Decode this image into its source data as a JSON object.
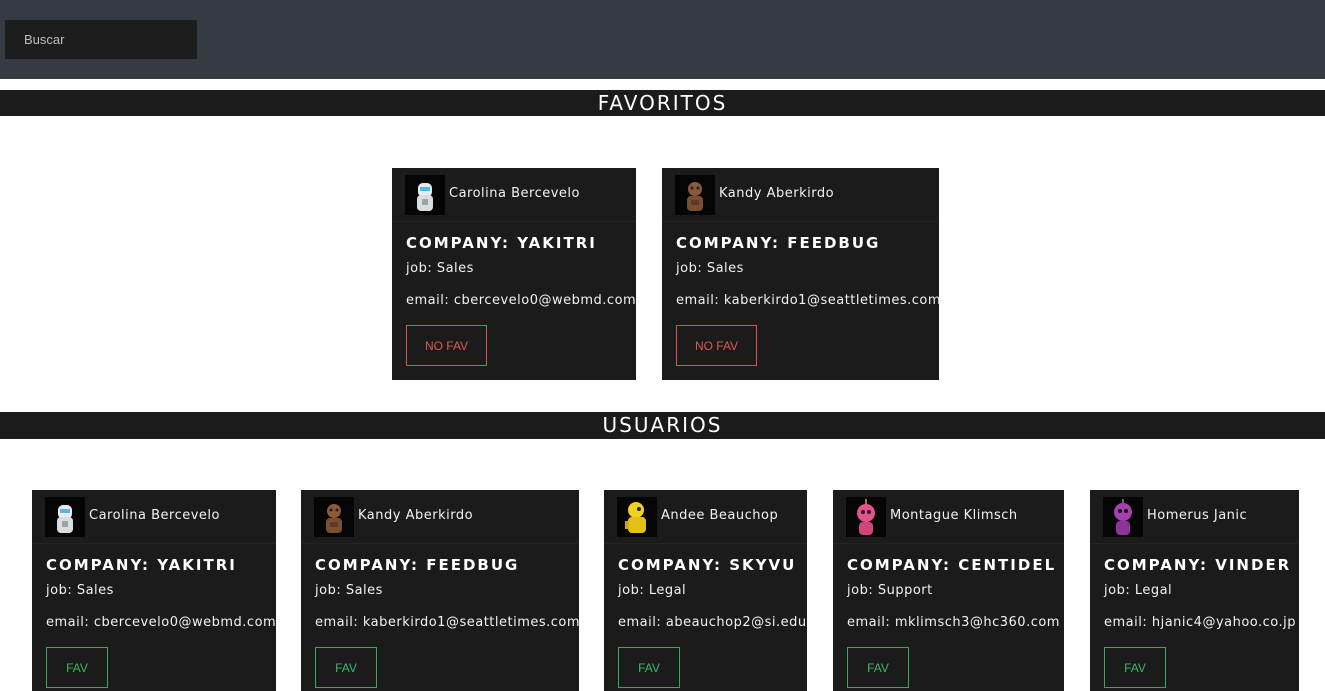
{
  "search": {
    "placeholder": "Buscar"
  },
  "sections": {
    "favorites_title": "FAVORITOS",
    "users_title": "USUARIOS"
  },
  "favorites": [
    {
      "name": "Carolina Bercevelo",
      "company": "COMPANY: YAKITRI",
      "job": "job: Sales",
      "email": "email: cbercevelo0@webmd.com",
      "button": "NO FAV",
      "avatar": "robot-white-avatar"
    },
    {
      "name": "Kandy Aberkirdo",
      "company": "COMPANY: FEEDBUG",
      "job": "job: Sales",
      "email": "email: kaberkirdo1@seattletimes.com",
      "button": "NO FAV",
      "avatar": "robot-brown-avatar"
    }
  ],
  "users": [
    {
      "name": "Carolina Bercevelo",
      "company": "COMPANY: YAKITRI",
      "job": "job: Sales",
      "email": "email: cbercevelo0@webmd.com",
      "button": "FAV",
      "avatar": "robot-white-avatar"
    },
    {
      "name": "Kandy Aberkirdo",
      "company": "COMPANY: FEEDBUG",
      "job": "job: Sales",
      "email": "email: kaberkirdo1@seattletimes.com",
      "button": "FAV",
      "avatar": "robot-brown-avatar"
    },
    {
      "name": "Andee Beauchop",
      "company": "COMPANY: SKYVU",
      "job": "job: Legal",
      "email": "email: abeauchop2@si.edu",
      "button": "FAV",
      "avatar": "robot-yellow-avatar"
    },
    {
      "name": "Montague Klimsch",
      "company": "COMPANY: CENTIDEL",
      "job": "job: Support",
      "email": "email: mklimsch3@hc360.com",
      "button": "FAV",
      "avatar": "robot-pink-avatar"
    },
    {
      "name": "Homerus Janic",
      "company": "COMPANY: VINDER",
      "job": "job: Legal",
      "email": "email: hjanic4@yahoo.co.jp",
      "button": "FAV",
      "avatar": "robot-purple-avatar"
    }
  ],
  "colors": {
    "topbar": "#363a43",
    "card": "#1b1b1b",
    "no_fav": "#e0584f",
    "fav": "#3fb56a"
  }
}
